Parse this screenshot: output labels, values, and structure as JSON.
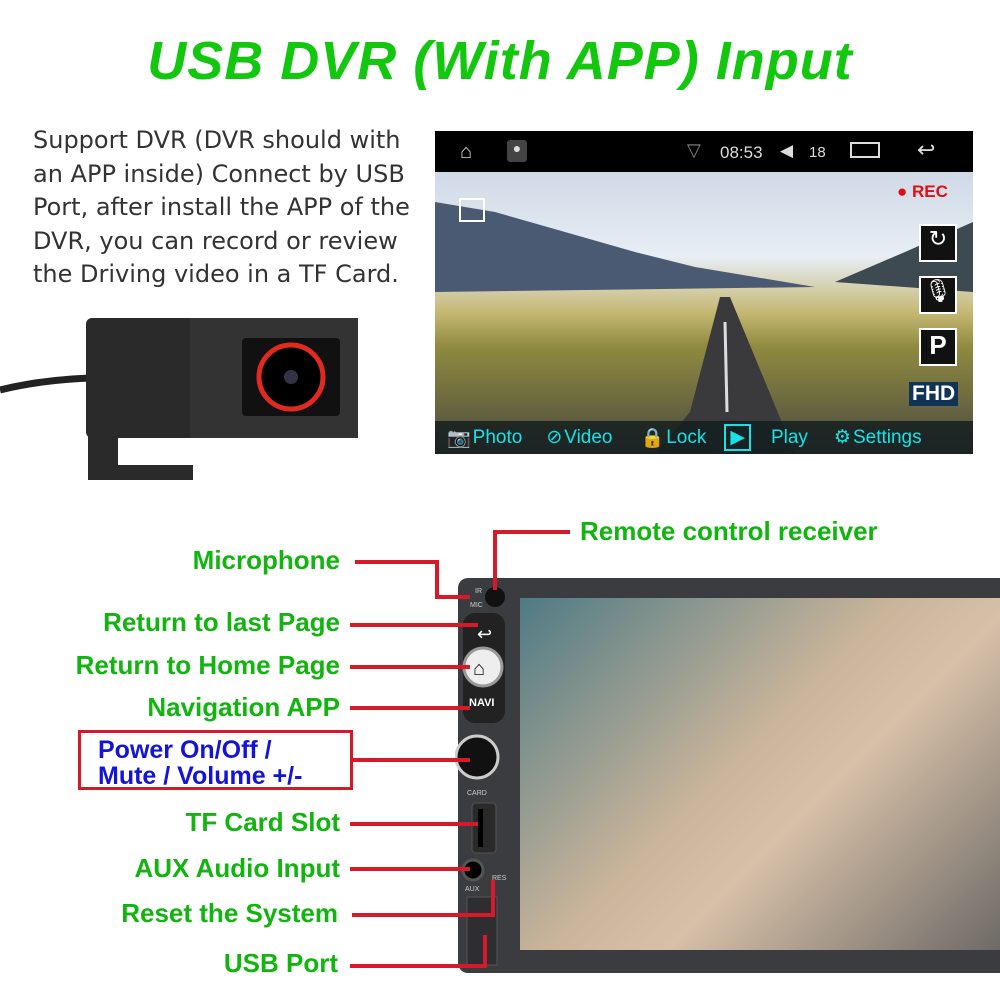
{
  "title": "USB DVR (With APP) Input",
  "description": "Support DVR (DVR should with an APP inside) Connect by USB Port, after install the APP of the DVR, you can record or review the Driving video in a TF Card.",
  "screen": {
    "status": {
      "time": "08:53",
      "volume": "18"
    },
    "rec_label": "REC",
    "resolution_badge": "FHD",
    "toolbar": [
      {
        "label": "Photo",
        "icon": "camera-icon"
      },
      {
        "label": "Video",
        "icon": "video-camera-icon"
      },
      {
        "label": "Lock",
        "icon": "lock-icon"
      },
      {
        "label": "Play",
        "icon": "play-icon"
      },
      {
        "label": "Settings",
        "icon": "gear-icon"
      }
    ]
  },
  "device": {
    "ir": "IR",
    "mic": "MIC",
    "navi": "NAVI",
    "card": "CARD",
    "aux": "AUX",
    "res": "RES"
  },
  "labels": {
    "remote": "Remote control receiver",
    "microphone": "Microphone",
    "return_last": "Return to last Page",
    "return_home": "Return to Home Page",
    "navigation": "Navigation APP",
    "power_line1": "Power On/Off /",
    "power_line2": "Mute / Volume +/-",
    "tf_card": "TF Card Slot",
    "aux": "AUX Audio Input",
    "reset": "Reset the System",
    "usb": "USB Port"
  },
  "colors": {
    "title": "#12c70e",
    "label": "#12b40f",
    "line": "#d6192b",
    "power": "#1414d8",
    "toolbar": "#15e3e8"
  }
}
